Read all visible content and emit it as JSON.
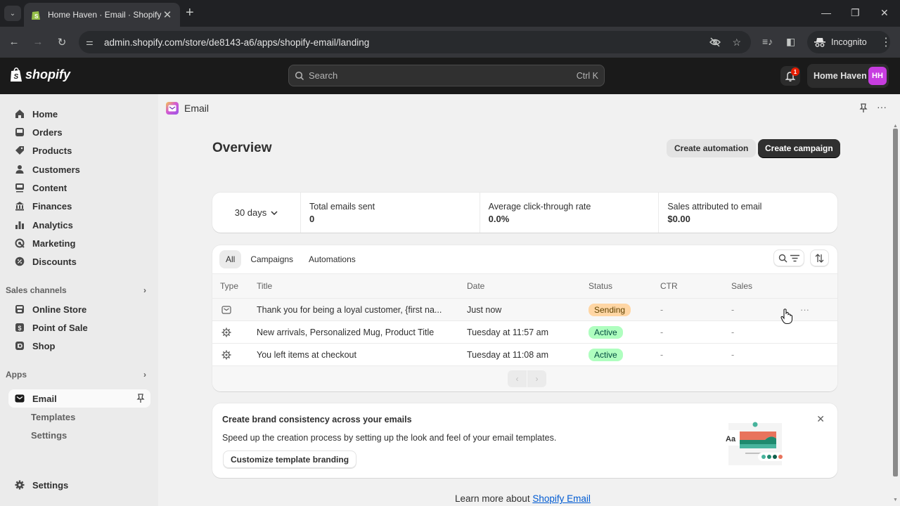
{
  "browser": {
    "tab_title": "Home Haven · Email · Shopify",
    "url": "admin.shopify.com/store/de8143-a6/apps/shopify-email/landing",
    "incognito_label": "Incognito"
  },
  "topbar": {
    "logo_text": "shopify",
    "search_placeholder": "Search",
    "search_shortcut": "Ctrl K",
    "notification_count": "1",
    "store_name": "Home Haven",
    "avatar_initials": "HH",
    "avatar_color": "#c73de0"
  },
  "sidebar": {
    "items": [
      {
        "label": "Home",
        "icon": "home-icon"
      },
      {
        "label": "Orders",
        "icon": "orders-icon"
      },
      {
        "label": "Products",
        "icon": "tag-icon"
      },
      {
        "label": "Customers",
        "icon": "person-icon"
      },
      {
        "label": "Content",
        "icon": "content-icon"
      },
      {
        "label": "Finances",
        "icon": "bank-icon"
      },
      {
        "label": "Analytics",
        "icon": "bar-chart-icon"
      },
      {
        "label": "Marketing",
        "icon": "target-icon"
      },
      {
        "label": "Discounts",
        "icon": "discount-icon"
      }
    ],
    "sales_channels_label": "Sales channels",
    "sales_channels": [
      {
        "label": "Online Store",
        "icon": "store-icon"
      },
      {
        "label": "Point of Sale",
        "icon": "pos-icon"
      },
      {
        "label": "Shop",
        "icon": "shop-icon"
      }
    ],
    "apps_label": "Apps",
    "active_app": "Email",
    "app_subitems": [
      "Templates",
      "Settings"
    ],
    "settings_label": "Settings"
  },
  "header": {
    "app_name": "Email",
    "page_title": "Overview",
    "create_automation": "Create automation",
    "create_campaign": "Create campaign"
  },
  "metrics": {
    "range": "30 days",
    "cells": [
      {
        "label": "Total emails sent",
        "value": "0"
      },
      {
        "label": "Average click-through rate",
        "value": "0.0%"
      },
      {
        "label": "Sales attributed to email",
        "value": "$0.00"
      }
    ]
  },
  "table": {
    "tabs": [
      "All",
      "Campaigns",
      "Automations"
    ],
    "selected_tab": "All",
    "columns": [
      "Type",
      "Title",
      "Date",
      "Status",
      "CTR",
      "Sales"
    ],
    "rows": [
      {
        "type": "campaign",
        "title": "Thank you for being a loyal customer, {first na...",
        "date": "Just now",
        "status": "Sending",
        "ctr": "-",
        "sales": "-"
      },
      {
        "type": "automation",
        "title": "New arrivals, Personalized Mug, Product Title",
        "date": "Tuesday at 11:57 am",
        "status": "Active",
        "ctr": "-",
        "sales": "-"
      },
      {
        "type": "automation",
        "title": "You left items at checkout",
        "date": "Tuesday at 11:08 am",
        "status": "Active",
        "ctr": "-",
        "sales": "-"
      }
    ]
  },
  "promo": {
    "title": "Create brand consistency across your emails",
    "text": "Speed up the creation process by setting up the look and feel of your email templates.",
    "button": "Customize template branding",
    "illus_label": "Aa"
  },
  "footer": {
    "learn_prefix": "Learn more about ",
    "learn_link": "Shopify Email"
  }
}
